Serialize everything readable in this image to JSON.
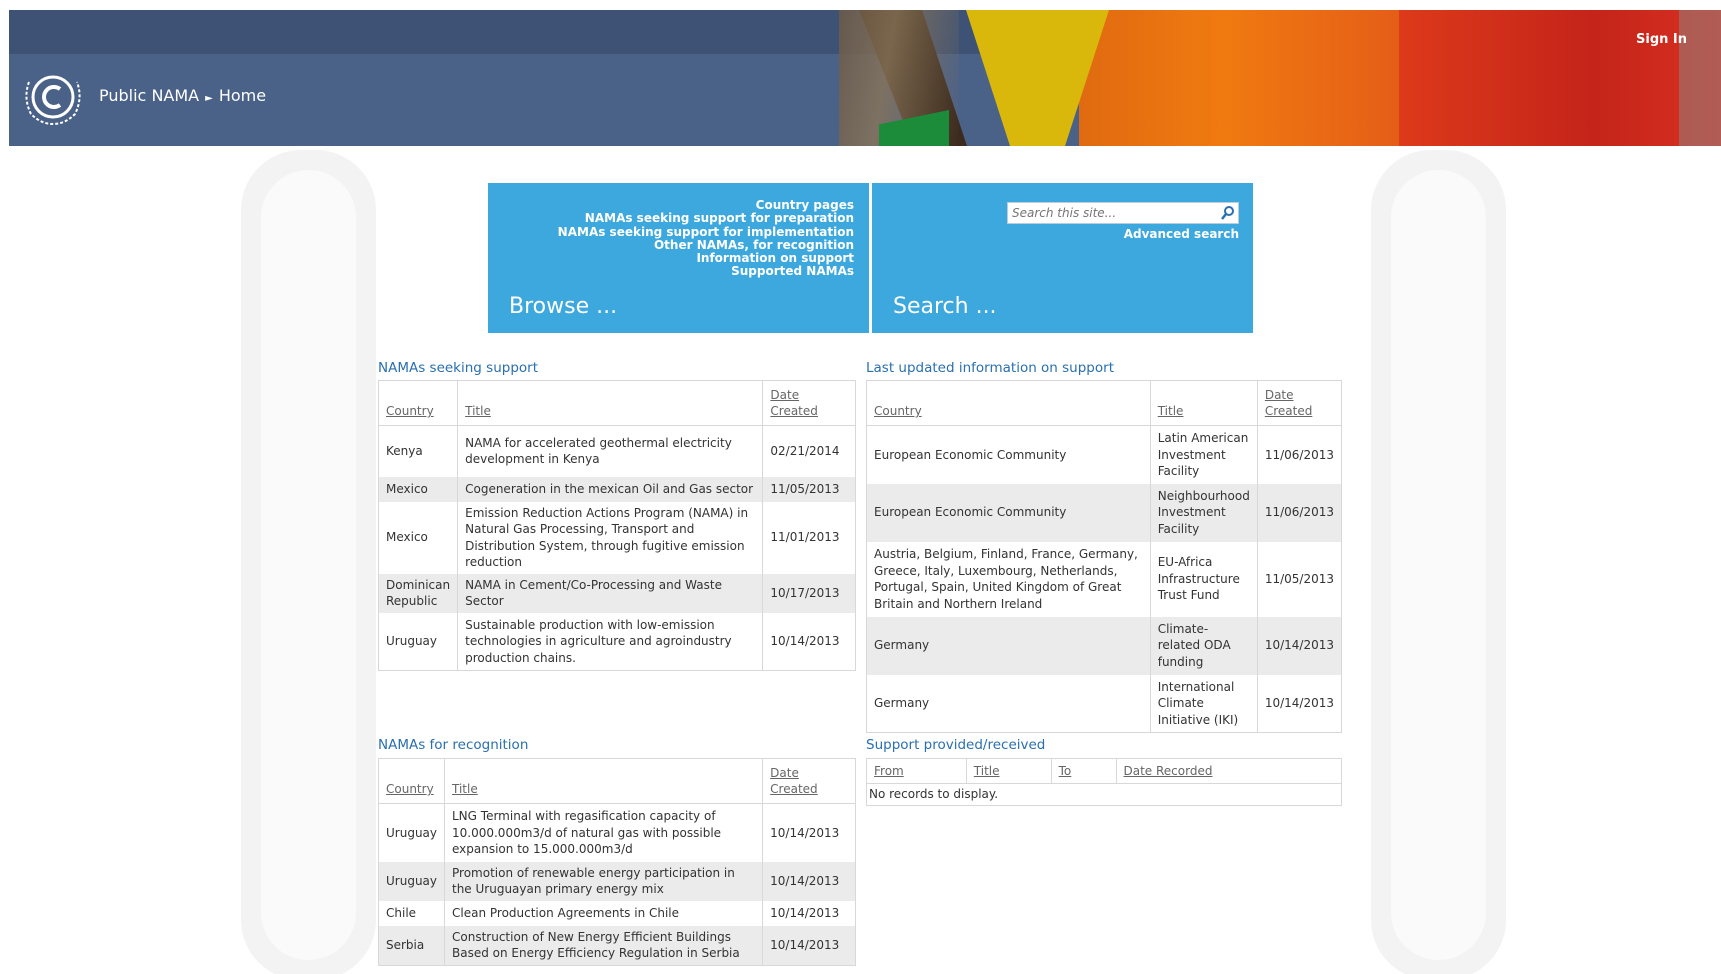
{
  "header": {
    "sign_in": "Sign In",
    "breadcrumb": {
      "root": "Public NAMA",
      "current": "Home"
    }
  },
  "browse": {
    "title": "Browse ...",
    "links": [
      "Country pages",
      "NAMAs seeking support for preparation",
      "NAMAs seeking support for implementation",
      "Other NAMAs, for recognition",
      "Information on support",
      "Supported NAMAs"
    ]
  },
  "search": {
    "title": "Search ...",
    "placeholder": "Search this site...",
    "advanced": "Advanced search"
  },
  "seeking": {
    "title": "NAMAs seeking support",
    "headers": {
      "country": "Country",
      "title": "Title",
      "date1": "Date",
      "date2": "Created"
    },
    "rows": [
      {
        "country": "Kenya",
        "title": "NAMA for accelerated geothermal electricity development in Kenya",
        "date": "02/21/2014"
      },
      {
        "country": "Mexico",
        "title": "Cogeneration in the mexican Oil and Gas sector",
        "date": "11/05/2013"
      },
      {
        "country": "Mexico",
        "title": "Emission Reduction Actions Program (NAMA) in Natural Gas Processing, Transport and Distribution System, through fugitive emission reduction",
        "date": "11/01/2013"
      },
      {
        "country": "Dominican Republic",
        "title": "NAMA in Cement/Co-Processing and Waste Sector",
        "date": "10/17/2013"
      },
      {
        "country": "Uruguay",
        "title": "Sustainable production with low-emission technologies in agriculture and agroindustry production chains.",
        "date": "10/14/2013"
      }
    ]
  },
  "recognition": {
    "title": "NAMAs for recognition",
    "headers": {
      "country": "Country",
      "title": "Title",
      "date1": "Date",
      "date2": "Created"
    },
    "rows": [
      {
        "country": "Uruguay",
        "title": "LNG Terminal with regasification capacity of 10.000.000m3/d of natural gas with possible expansion to 15.000.000m3/d",
        "date": "10/14/2013"
      },
      {
        "country": "Uruguay",
        "title": "Promotion of renewable energy participation in the Uruguayan primary energy mix",
        "date": "10/14/2013"
      },
      {
        "country": "Chile",
        "title": "Clean Production Agreements in Chile",
        "date": "10/14/2013"
      },
      {
        "country": "Serbia",
        "title": "Construction of New Energy Efficient Buildings Based on Energy Efficiency Regulation in Serbia",
        "date": "10/14/2013"
      }
    ]
  },
  "support_info": {
    "title": "Last updated information on support",
    "headers": {
      "country": "Country",
      "title": "Title",
      "date1": "Date",
      "date2": "Created"
    },
    "rows": [
      {
        "country": "European Economic Community",
        "title": "Latin American Investment Facility",
        "date": "11/06/2013"
      },
      {
        "country": "European Economic Community",
        "title": "Neighbourhood Investment Facility",
        "date": "11/06/2013"
      },
      {
        "country": "Austria, Belgium, Finland, France, Germany, Greece, Italy, Luxembourg, Netherlands, Portugal, Spain, United Kingdom of Great Britain and Northern Ireland",
        "title": "EU-Africa Infrastructure Trust Fund",
        "date": "11/05/2013"
      },
      {
        "country": "Germany",
        "title": "Climate-related ODA funding",
        "date": "10/14/2013"
      },
      {
        "country": "Germany",
        "title": "International Climate Initiative (IKI)",
        "date": "10/14/2013"
      }
    ]
  },
  "provided": {
    "title": "Support provided/received",
    "headers": {
      "from": "From",
      "title": "Title",
      "to": "To",
      "date": "Date Recorded"
    },
    "empty": "No records to display."
  },
  "colors": {
    "tile": "#3da8dd",
    "header": "#4a6188",
    "link": "#2a6fb0"
  }
}
